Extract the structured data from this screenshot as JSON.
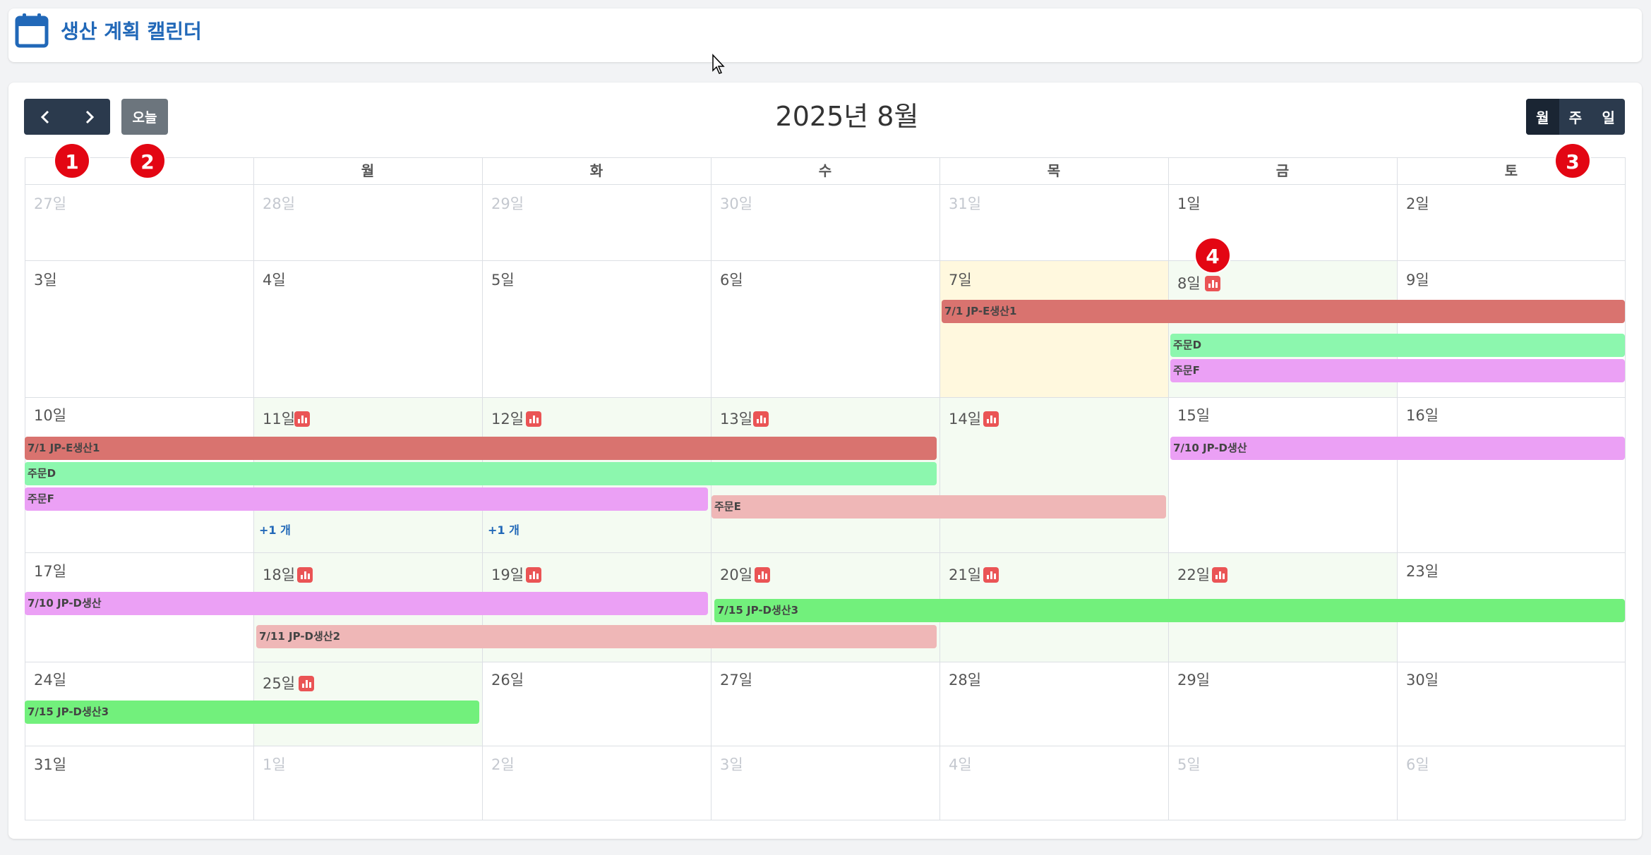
{
  "header": {
    "title": "생산 계획 캘린더",
    "icon": "calendar-icon"
  },
  "toolbar": {
    "prev_icon": "chevron-left-icon",
    "next_icon": "chevron-right-icon",
    "today_label": "오늘",
    "month_title": "2025년 8월",
    "views": [
      {
        "label": "월",
        "active": true
      },
      {
        "label": "주",
        "active": false
      },
      {
        "label": "일",
        "active": false
      }
    ]
  },
  "calendar": {
    "weekdays": [
      "",
      "월",
      "화",
      "수",
      "목",
      "금",
      "토"
    ],
    "weeks": [
      [
        "27일",
        "28일",
        "29일",
        "30일",
        "31일",
        "1일",
        "2일"
      ],
      [
        "3일",
        "4일",
        "5일",
        "6일",
        "7일",
        "8일",
        "9일"
      ],
      [
        "10일",
        "11일",
        "12일",
        "13일",
        "14일",
        "15일",
        "16일"
      ],
      [
        "17일",
        "18일",
        "19일",
        "20일",
        "21일",
        "22일",
        "23일"
      ],
      [
        "24일",
        "25일",
        "26일",
        "27일",
        "28일",
        "29일",
        "30일"
      ],
      [
        "31일",
        "1일",
        "2일",
        "3일",
        "4일",
        "5일",
        "6일"
      ]
    ],
    "events": [
      {
        "label": "7/1 JP-E생산1",
        "color": "#d9736f"
      },
      {
        "label": "주문D",
        "color": "#8cf7ae"
      },
      {
        "label": "주문F",
        "color": "#eba0f5"
      },
      {
        "label": "7/1 JP-E생산1",
        "color": "#d9736f"
      },
      {
        "label": "주문D",
        "color": "#8cf7ae"
      },
      {
        "label": "주문F",
        "color": "#eba0f5"
      },
      {
        "label": "주문E",
        "color": "#efb7b7"
      },
      {
        "label": "7/10 JP-D생산",
        "color": "#eba0f5"
      },
      {
        "label": "7/10 JP-D생산",
        "color": "#eba0f5"
      },
      {
        "label": "7/15 JP-D생산3",
        "color": "#72f07c"
      },
      {
        "label": "7/11 JP-D생산2",
        "color": "#efb7b7"
      },
      {
        "label": "7/15 JP-D생산3",
        "color": "#72f07c"
      }
    ],
    "more_links": [
      "+1 개",
      "+1 개"
    ]
  },
  "annotations": [
    "1",
    "2",
    "3",
    "4"
  ],
  "colors": {
    "accent": "#2168b8",
    "nav_dark": "#2b3a4d",
    "today_bg": "#fff8de",
    "busy_bg": "#f4fbf2",
    "marker": "#e30613"
  }
}
